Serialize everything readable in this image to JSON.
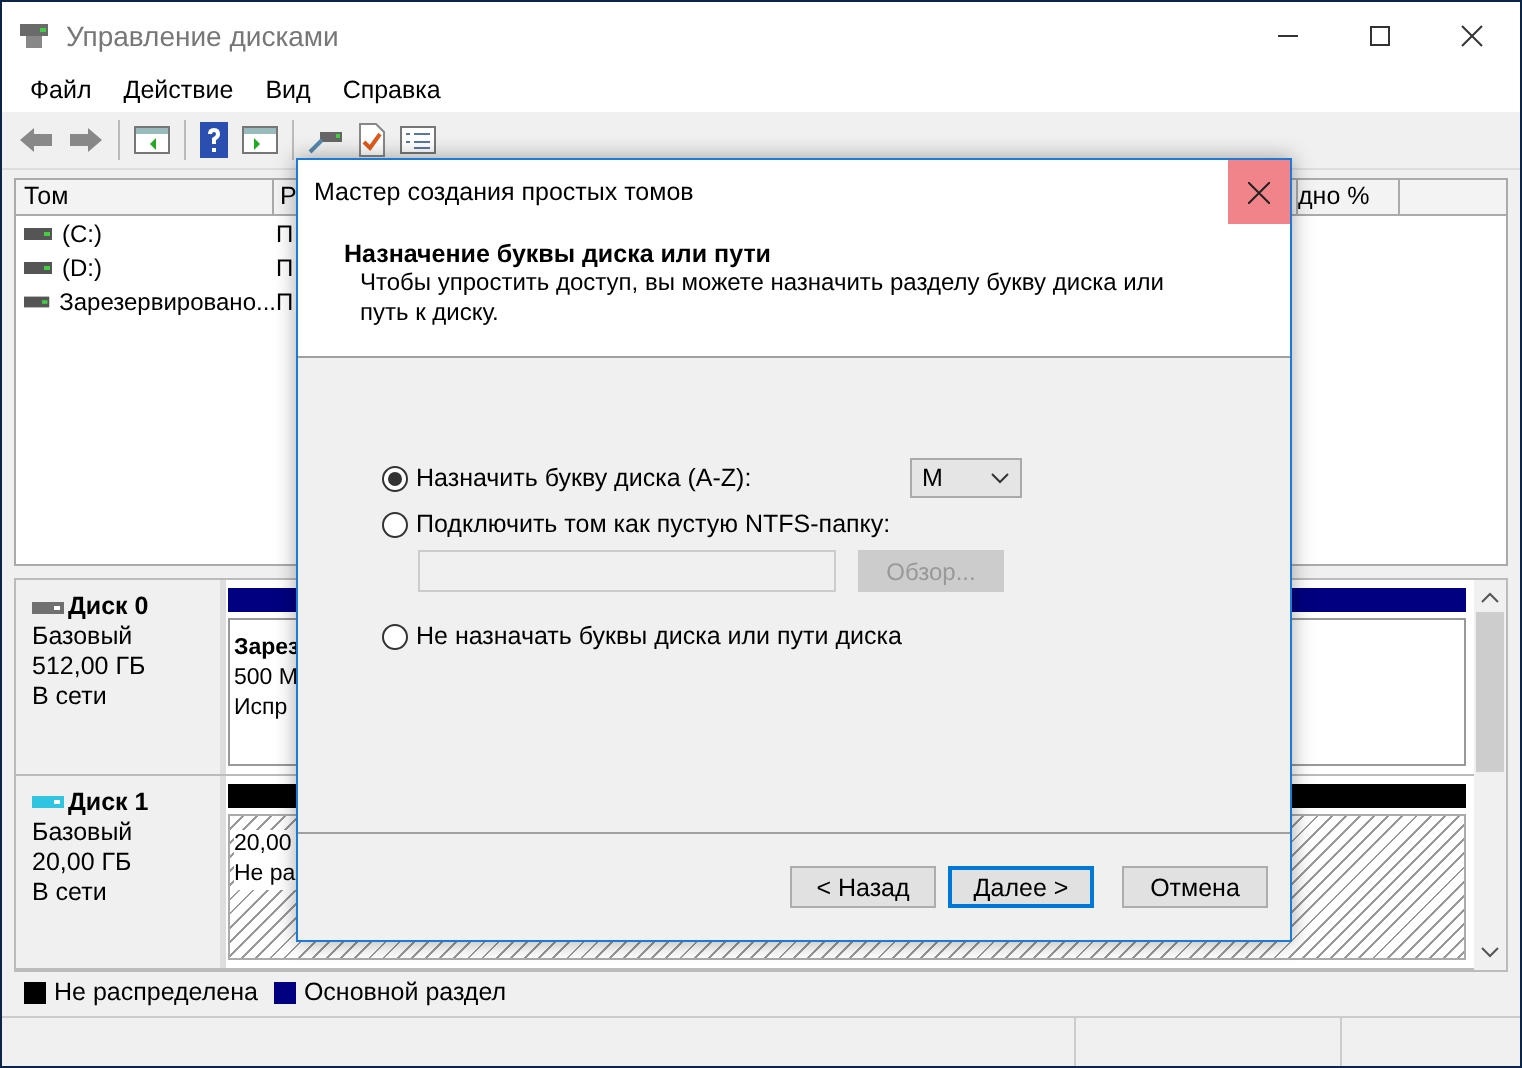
{
  "window": {
    "title": "Управление дисками"
  },
  "menu": [
    {
      "label": "Файл"
    },
    {
      "label": "Действие"
    },
    {
      "label": "Вид"
    },
    {
      "label": "Справка"
    }
  ],
  "volume_table": {
    "columns": [
      {
        "label": "Том"
      },
      {
        "label": "Р"
      },
      {
        "label": "дно %"
      }
    ],
    "rows": [
      {
        "cells": [
          "(C:)",
          "П"
        ]
      },
      {
        "cells": [
          "(D:)",
          "П"
        ]
      },
      {
        "cells": [
          "Зарезервировано...",
          "П"
        ]
      }
    ]
  },
  "disks": [
    {
      "name": "Диск 0",
      "type": "Базовый",
      "size": "512,00 ГБ",
      "status": "В сети",
      "color": "#707070",
      "partition": {
        "kind": "primary",
        "lines": [
          "Зарез",
          "500 М",
          "Испр"
        ]
      }
    },
    {
      "name": "Диск 1",
      "type": "Базовый",
      "size": "20,00 ГБ",
      "status": "В сети",
      "color": "#2fc4e0",
      "partition": {
        "kind": "unallocated",
        "lines": [
          "20,00",
          "Не ра"
        ]
      }
    }
  ],
  "legend": [
    {
      "label": "Не распределена",
      "color": "#000000"
    },
    {
      "label": "Основной раздел",
      "color": "#000080"
    }
  ],
  "dialog": {
    "title": "Мастер создания простых томов",
    "heading": "Назначение буквы диска или пути",
    "subtitle": "Чтобы упростить доступ, вы можете назначить разделу букву диска или путь к диску.",
    "options": [
      {
        "kind": "letter",
        "label": "Назначить букву диска (A-Z):",
        "selected": true,
        "value": "M"
      },
      {
        "kind": "folder",
        "label": "Подключить том как пустую NTFS-папку:",
        "selected": false,
        "browse": "Обзор...",
        "disabled": true
      },
      {
        "kind": "none",
        "label": "Не назначать буквы диска или пути диска",
        "selected": false
      }
    ],
    "buttons": [
      {
        "label": "< Назад",
        "default": false
      },
      {
        "label": "Далее >",
        "default": true
      },
      {
        "label": "Отмена",
        "default": false
      }
    ]
  }
}
